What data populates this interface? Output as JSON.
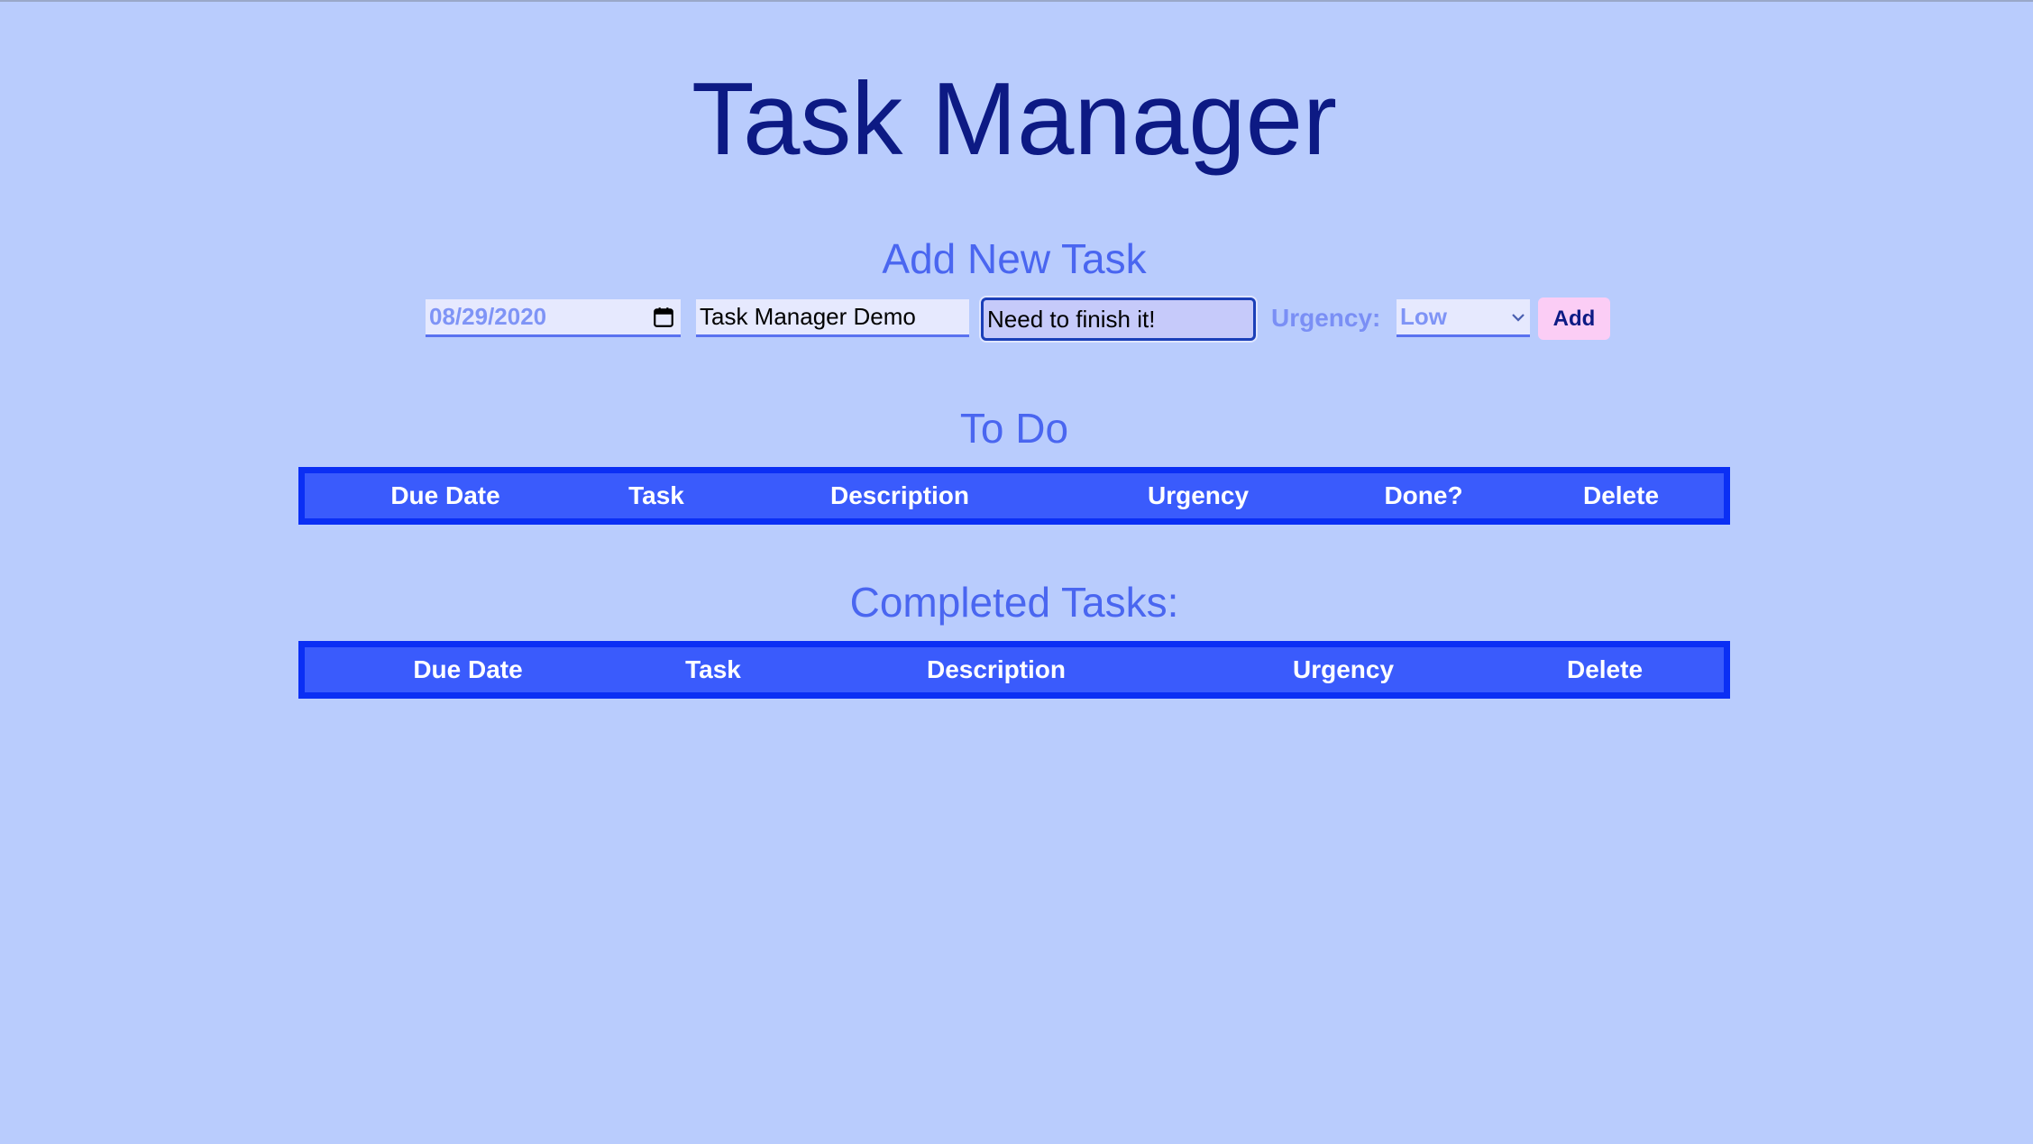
{
  "page": {
    "title": "Task Manager"
  },
  "add_task": {
    "heading": "Add New Task",
    "due_date_value": "08/29/2020",
    "task_value": "Task Manager Demo",
    "description_value": "Need to finish it!",
    "urgency_label": "Urgency:",
    "urgency_selected": "Low",
    "add_label": "Add"
  },
  "todo": {
    "heading": "To Do",
    "columns": [
      "Due Date",
      "Task",
      "Description",
      "Urgency",
      "Done?",
      "Delete"
    ]
  },
  "completed": {
    "heading": "Completed Tasks:",
    "columns": [
      "Due Date",
      "Task",
      "Description",
      "Urgency",
      "Delete"
    ]
  },
  "icons": {
    "date_picker": "calendar-icon",
    "select_arrow": "chevron-down-icon"
  },
  "colors": {
    "background": "#b9ccfd",
    "title": "#0d1a84",
    "heading": "#4a66f0",
    "table_fill": "#3a5bfc",
    "table_border": "#0b2ff4",
    "add_button": "#fbcdf5"
  }
}
